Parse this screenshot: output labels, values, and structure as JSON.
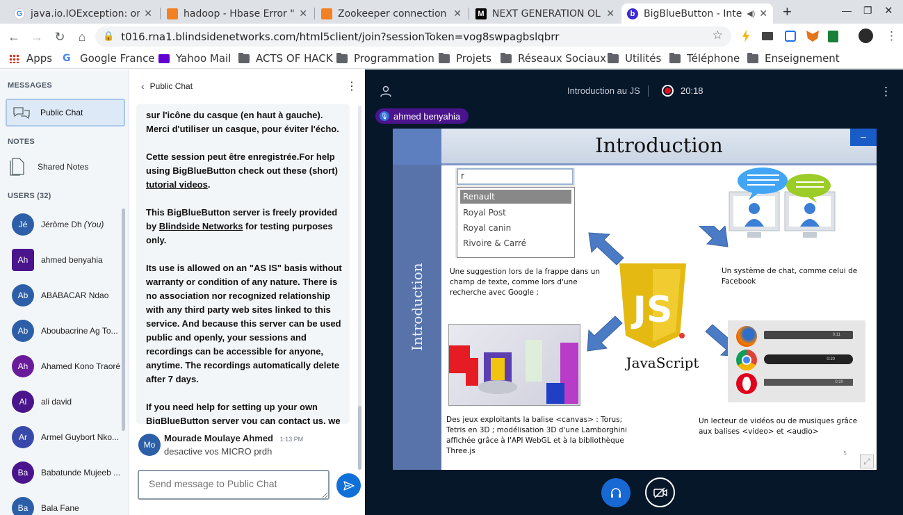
{
  "browser": {
    "tabs": [
      {
        "title": "java.io.IOException: or",
        "favicon": "google-favicon",
        "active": false
      },
      {
        "title": "hadoop - Hbase Error \"",
        "favicon": "stackoverflow-favicon",
        "active": false
      },
      {
        "title": "Zookeeper connection",
        "favicon": "stackoverflow-favicon",
        "active": false
      },
      {
        "title": "NEXT GENERATION OL",
        "favicon": "medium-favicon",
        "active": false
      },
      {
        "title": "BigBlueButton - Inte",
        "favicon": "bigbluebutton-favicon",
        "active": true
      }
    ],
    "new_tab": "+",
    "url": "t016.rna1.blindsidenetworks.com/html5client/join?sessionToken=vog8swpagbslqbrr",
    "bookmarks": [
      {
        "label": "Apps",
        "icon": "apps-grid-icon"
      },
      {
        "label": "Google France",
        "icon": "google-icon"
      },
      {
        "label": "Yahoo Mail",
        "icon": "yahoo-mail-icon"
      },
      {
        "label": "ACTS OF HACK",
        "icon": "folder-icon"
      },
      {
        "label": "Programmation",
        "icon": "folder-icon"
      },
      {
        "label": "Projets",
        "icon": "folder-icon"
      },
      {
        "label": "Réseaux Sociaux",
        "icon": "folder-icon"
      },
      {
        "label": "Utilités",
        "icon": "folder-icon"
      },
      {
        "label": "Téléphone",
        "icon": "folder-icon"
      },
      {
        "label": "Enseignement",
        "icon": "folder-icon"
      }
    ]
  },
  "sidebar": {
    "messages_heading": "MESSAGES",
    "public_chat_label": "Public Chat",
    "notes_heading": "NOTES",
    "shared_notes_label": "Shared Notes",
    "users_heading": "USERS (32)",
    "users": [
      {
        "initials": "Jé",
        "name": "Jérôme Dh",
        "suffix": "(You)",
        "color": "#2c5fa8",
        "mic": true
      },
      {
        "initials": "Ah",
        "name": "ahmed benyahia",
        "suffix": "",
        "color": "#4a148c",
        "mic": false,
        "presenter": true
      },
      {
        "initials": "Ab",
        "name": "ABABACAR Ndao",
        "suffix": "",
        "color": "#2c5fa8",
        "mic": false
      },
      {
        "initials": "Ab",
        "name": "Aboubacrine Ag To...",
        "suffix": "",
        "color": "#2c5fa8",
        "mic": true
      },
      {
        "initials": "Ah",
        "name": "Ahamed Kono Traoré",
        "suffix": "",
        "color": "#6a1b9a",
        "mic": true
      },
      {
        "initials": "Al",
        "name": "ali david",
        "suffix": "",
        "color": "#4a148c",
        "mic": false
      },
      {
        "initials": "Ar",
        "name": "Armel Guybort Nko...",
        "suffix": "",
        "color": "#3949ab",
        "mic": false
      },
      {
        "initials": "Ba",
        "name": "Babatunde Mujeeb ...",
        "suffix": "",
        "color": "#4a148c",
        "mic": false
      },
      {
        "initials": "Ba",
        "name": "Bala Fane",
        "suffix": "",
        "color": "#2c5fa8",
        "mic": false
      }
    ]
  },
  "chat": {
    "title": "Public Chat",
    "welcome_p1_normal": "sur l'icône du casque (en haut à gauche).",
    "welcome_p1_bold": " Merci d'utiliser un casque, pour éviter l'écho.",
    "welcome_p2_a": "Cette session peut être enregistrée.For help using BigBlueButton check out these (short) ",
    "welcome_p2_link": "tutorial videos",
    "welcome_p2_b": ".",
    "welcome_p3_a": "This BigBlueButton server is freely provided by ",
    "welcome_p3_link": "Blindside Networks",
    "welcome_p3_b": " for testing purposes only.",
    "welcome_p4": "Its use is allowed on an \"AS IS\" basis without warranty or condition of any nature. There is no association nor recognized relationship with any third party web sites linked to this service. And because this server can be used public and openly, your sessions and recordings can be accessible for anyone, anytime. The recordings automatically delete after 7 days.",
    "welcome_p5_a": "If you need help for setting up your own BigBlueButton server you can ",
    "welcome_p5_link": "contact us",
    "welcome_p5_b": ", we will be more than happy to help.",
    "last_message": {
      "initials": "Mo",
      "author": "Mourade Moulaye Ahmed",
      "time": "1:13 PM",
      "text": "desactive vos MICRO prdh"
    },
    "input_placeholder": "Send message to Public Chat"
  },
  "presentation": {
    "session_title": "Introduction au JS",
    "recording_time": "20:18",
    "talker_name": "ahmed benyahia",
    "slide": {
      "title": "Introduction",
      "side_label": "Introduction",
      "autocomplete_input": "r",
      "autocomplete_items": [
        "Renault",
        "Royal Post",
        "Royal canin",
        "Rivoire & Carré"
      ],
      "caption_suggest": "Une suggestion lors de la frappe dans un champ de texte, comme lors d'une recherche avec Google ;",
      "caption_chat": "Un système de chat, comme celui de Facebook",
      "caption_games": "Des jeux exploitants la balise <canvas> : Torus; Tetris en 3D ; modélisation 3D d'une Lamborghini affichée grâce à l'API WebGL et à la bibliothèque Three.js",
      "caption_media": "Un lecteur de vidéos ou de musiques grâce aux balises <video> et <audio>",
      "js_logo_text": "JS",
      "js_label": "JavaScript",
      "page_number": "5",
      "player_times": [
        "0:11",
        "0:20",
        "0:20"
      ]
    }
  },
  "colors": {
    "sidebar_bg": "#f3f6f9",
    "main_bg": "#06172a",
    "accent": "#0f70d7",
    "talker_bg": "#4a148c"
  }
}
